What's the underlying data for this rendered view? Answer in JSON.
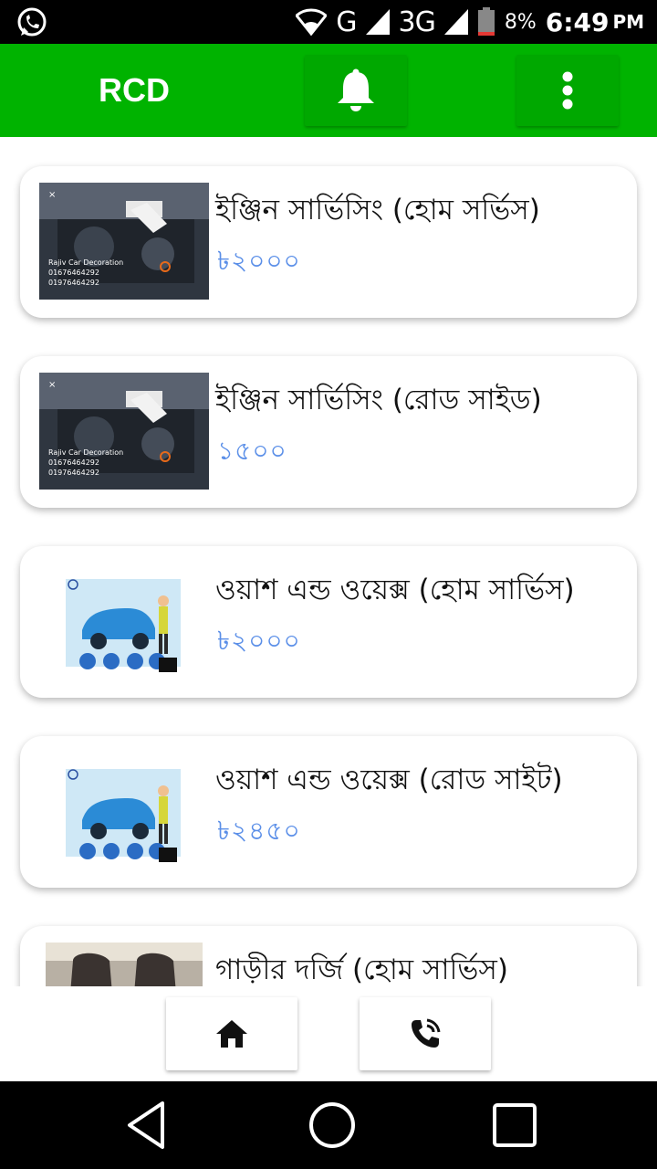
{
  "status_bar": {
    "left_icon": "whatsapp-icon",
    "network": "G",
    "network2": "3G",
    "battery_percent": "8%",
    "time": "6:49",
    "ampm": "PM"
  },
  "app_bar": {
    "title": "RCD",
    "notifications_icon": "bell-icon",
    "menu_icon": "more-vert-icon",
    "color": "#00b300"
  },
  "services": [
    {
      "title": "ইঞ্জিন সার্ভিসিং (হোম সর্ভিস)",
      "price": "৳২০০০",
      "thumb": "engine"
    },
    {
      "title": "ইঞ্জিন সার্ভিসিং (রোড সাইড)",
      "price": "১৫০০",
      "thumb": "engine"
    },
    {
      "title": "ওয়াশ এন্ড ওয়েক্স (হোম সার্ভিস)",
      "price": "৳২০০০",
      "thumb": "wash"
    },
    {
      "title": "ওয়াশ এন্ড ওয়েক্স (রোড সাইট)",
      "price": "৳২৪৫০",
      "thumb": "wash"
    },
    {
      "title": "গাড়ীর দর্জি (হোম সার্ভিস)",
      "price": "",
      "thumb": "seat"
    }
  ],
  "thumb_text": {
    "engine_line1": "Rajiv Car Decoration",
    "engine_line2": "01676464292",
    "engine_line3": "01976464292"
  },
  "bottom_bar": {
    "home_icon": "home-icon",
    "call_icon": "phone-call-icon"
  },
  "price_color": "#5b8fe8"
}
